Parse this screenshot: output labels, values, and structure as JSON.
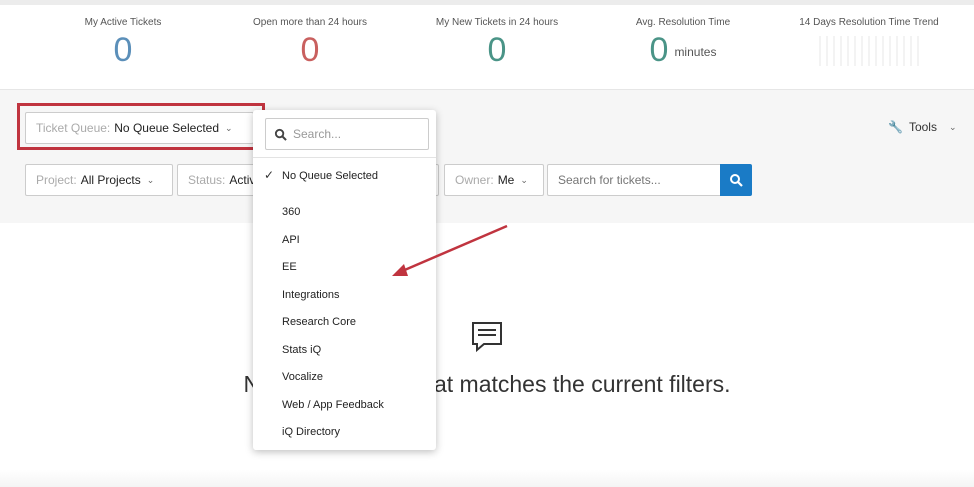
{
  "stats": [
    {
      "label": "My Active Tickets",
      "value": "0",
      "color": "#5b8fb9"
    },
    {
      "label": "Open more than 24 hours",
      "value": "0",
      "color": "#c9605f"
    },
    {
      "label": "My New Tickets in 24 hours",
      "value": "0",
      "color": "#4a9487"
    },
    {
      "label": "Avg. Resolution Time",
      "value": "0",
      "unit": "minutes",
      "color": "#4a9487"
    },
    {
      "label": "14 Days Resolution Time Trend"
    }
  ],
  "filters": {
    "queue_label": "Ticket Queue:",
    "queue_value": "No Queue Selected",
    "project_label": "Project:",
    "project_value": "All Projects",
    "status_label": "Status:",
    "status_value": "Active",
    "owner_label": "Owner:",
    "owner_value": "Me",
    "search_placeholder": "Search for tickets...",
    "tools_label": "Tools"
  },
  "dropdown": {
    "search_placeholder": "Search...",
    "selected": "No Queue Selected",
    "options": [
      "360",
      "API",
      "EE",
      "Integrations",
      "Research Core",
      "Stats iQ",
      "Vocalize",
      "Web / App Feedback",
      "iQ Directory"
    ]
  },
  "empty": {
    "message": "No tickets found that matches the current filters."
  },
  "colors": {
    "accent": "#1a7bc6",
    "highlight": "#c0343f"
  }
}
